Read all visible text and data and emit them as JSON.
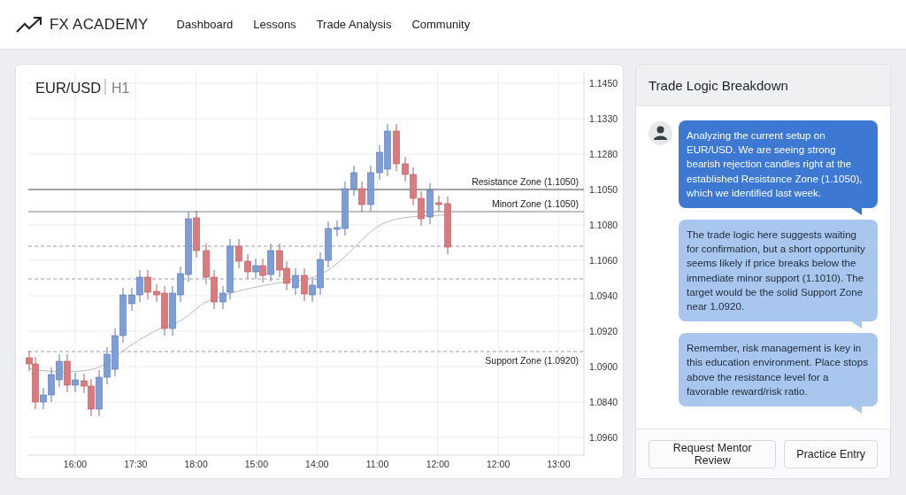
{
  "app": {
    "name": "FX ACADEMY"
  },
  "nav": [
    {
      "label": "Dashboard"
    },
    {
      "label": "Lessons"
    },
    {
      "label": "Trade Analysis"
    },
    {
      "label": "Community"
    }
  ],
  "chart": {
    "symbol": "EUR/USD",
    "timeframe": "H1",
    "y_labels": [
      "1.1450",
      "1.1330",
      "1.1280",
      "1.1050",
      "1.1080",
      "1.1060",
      "1.0940",
      "1.0920",
      "1.0900",
      "1.0840",
      "1.0960"
    ],
    "x_labels": [
      "16:00",
      "17:30",
      "18:00",
      "15:00",
      "14:00",
      "11:00",
      "12:00",
      "12:00",
      "13:00"
    ],
    "levels": [
      {
        "kind": "solid",
        "label": "Resistance Zone (1.1050)"
      },
      {
        "kind": "light",
        "label": "Minort Zone (1.1050)"
      },
      {
        "kind": "dashed"
      },
      {
        "kind": "dashed"
      },
      {
        "kind": "dashed",
        "label": "Support Zone (1.0920)"
      }
    ]
  },
  "panel": {
    "title": "Trade Logic Breakdown",
    "messages": [
      {
        "kind": "primary",
        "text": "Analyzing the current setup on EUR/USD. We are seeing strong bearish rejection candles right at the established Resistance Zone (1.1050), which we identified last week."
      },
      {
        "kind": "secondary",
        "text": "The trade logic here suggests waiting for confirmation, but a short opportunity seems likely if price breaks below the immediate minor support (1.1010). The target would be the solid Support Zone near 1.0920."
      },
      {
        "kind": "secondary",
        "text": "Remember, risk management is key in this education environment. Place stops above the resistance level for a favorable reward/risk ratio."
      }
    ],
    "buttons": [
      {
        "label": "Request Mentor Review"
      },
      {
        "label": "Practice Entry"
      }
    ]
  }
}
